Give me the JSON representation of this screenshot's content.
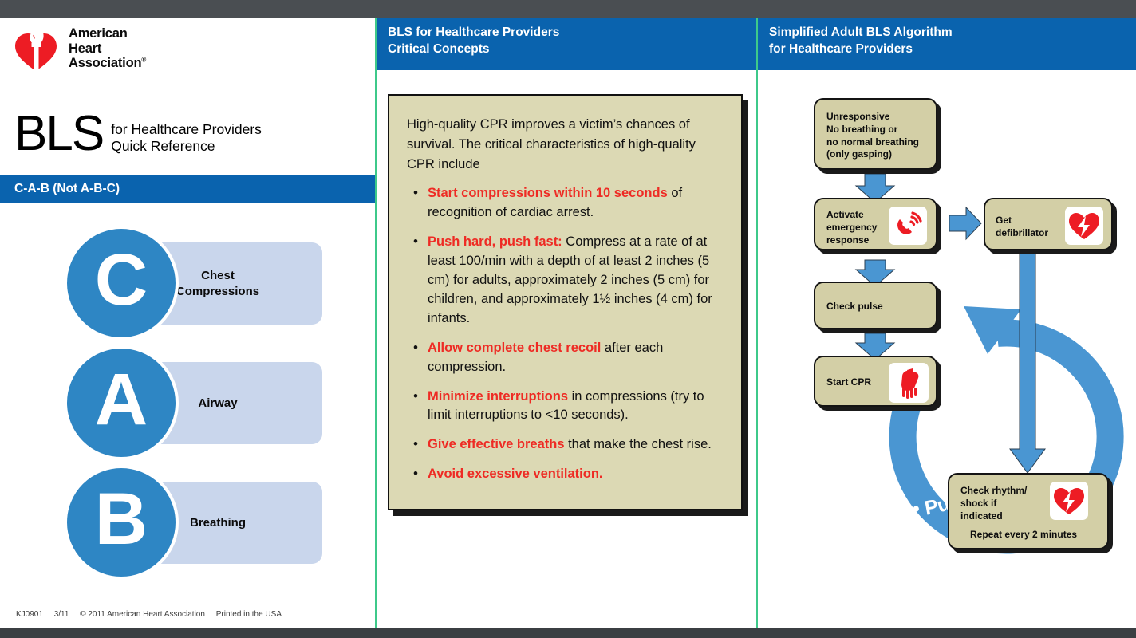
{
  "brand": {
    "logo_icon": "aha-heart-torch-icon",
    "name_line1": "American",
    "name_line2": "Heart",
    "name_line3": "Association",
    "registered_mark": "®",
    "red": "#ed1c24"
  },
  "colors": {
    "header_blue": "#0a63ae",
    "circle_blue": "#2e86c4",
    "panel_lavender": "#c9d6ec",
    "box_khaki": "#d3cfa6",
    "concept_khaki": "#dcd9b4",
    "accent_red": "#ee2b24",
    "divider_green": "#3ec98a",
    "chrome_gray": "#4a4e52"
  },
  "title": {
    "acronym": "BLS",
    "sub_line1": "for Healthcare Providers",
    "sub_line2": "Quick Reference"
  },
  "cab": {
    "bar_label": "C-A-B (Not A-B-C)",
    "items": [
      {
        "letter": "C",
        "label": "Chest\nCompressions"
      },
      {
        "letter": "A",
        "label": "Airway"
      },
      {
        "letter": "B",
        "label": "Breathing"
      }
    ]
  },
  "footer": {
    "code": "KJ0901",
    "date": "3/11",
    "copyright": "© 2011 American Heart Association",
    "printed": "Printed in the USA"
  },
  "middle": {
    "header_line1": "BLS for Healthcare Providers",
    "header_line2": "Critical Concepts",
    "intro": "High-quality CPR improves a victim’s chances of survival. The critical characteristics of high-quality CPR include",
    "bullets": [
      {
        "bold": "Start compressions within 10 seconds",
        "rest": " of recognition of cardiac arrest."
      },
      {
        "bold": "Push hard, push fast:",
        "rest": " Compress at a rate of at least 100/min with a depth of at least 2 inches (5 cm) for adults, approximately 2 inches (5 cm) for children, and approximately 1½ inches (4 cm) for infants."
      },
      {
        "bold": "Allow complete chest recoil",
        "rest": " after each compression."
      },
      {
        "bold": "Minimize interruptions",
        "rest": " in compressions (try to limit interruptions to <10 seconds)."
      },
      {
        "bold": "Give effective breaths",
        "rest": " that make the chest rise."
      },
      {
        "bold": "Avoid excessive ventilation.",
        "rest": ""
      }
    ]
  },
  "right": {
    "header_line1": "Simplified Adult BLS Algorithm",
    "header_line2": "for Healthcare Providers",
    "nodes": {
      "unresponsive": "Unresponsive\nNo breathing or\nno normal breathing\n(only gasping)",
      "activate": "Activate\nemergency\nresponse",
      "activate_icon": "phone-ringing-icon",
      "defib": "Get\ndefibrillator",
      "defib_icon": "aed-heart-bolt-icon",
      "pulse": "Check pulse",
      "cpr": "Start CPR",
      "cpr_icon": "cpr-hands-icon",
      "rhythm_line1": "Check rhythm/",
      "rhythm_line2": "shock if",
      "rhythm_line3": "indicated",
      "rhythm_repeat": "Repeat every 2 minutes",
      "rhythm_icon": "aed-heart-bolt-icon"
    },
    "cycle_label": "Push Hard • Push Fast"
  }
}
